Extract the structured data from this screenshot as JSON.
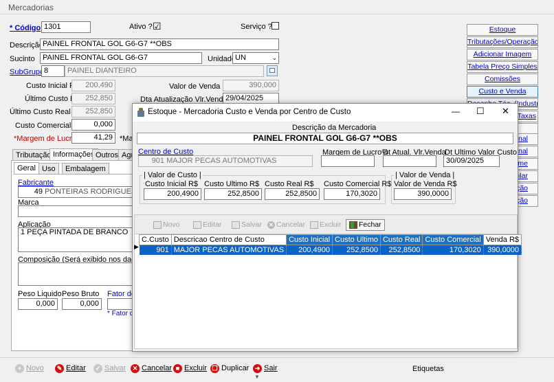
{
  "window_title": "Mercadorias",
  "form": {
    "codigo_label": "* Código",
    "codigo_value": "1301",
    "ativo_label": "Ativo ?",
    "ativo_checked": "☑",
    "servico_label": "Serviço ?",
    "descricao_label": "Descrição",
    "descricao_value": "PAINEL FRONTAL GOL G6-G7 **OBS",
    "sucinto_label": "Sucinto",
    "sucinto_value": "PAINEL FRONTAL GOL G6-G7",
    "unidade_label": "Unidade",
    "unidade_value": "UN",
    "subgrupo_label": "SubGrupo",
    "subgrupo_code": "8",
    "subgrupo_name": "PAINEL DIANTEIRO",
    "custo_inicial_label": "Custo Inicial R$",
    "custo_inicial_value": "200,490",
    "ultimo_custo_label": "Último Custo R$",
    "ultimo_custo_value": "252,850",
    "ultimo_custo_real_label": "Último Custo Real R$",
    "ultimo_custo_real_value": "252,850",
    "custo_comercial_label": "Custo Comercial R$",
    "custo_comercial_value": "0,000",
    "margem_label": "*Margem de Lucro%",
    "margem_value": "41,29",
    "margem_trunc": "*Ma",
    "valor_venda_label": "Valor de Venda R$",
    "valor_venda_value": "390,000",
    "dta_atualizacao_label": "Dta Atualização Vlr.Venda",
    "dta_atualizacao_value": "29/04/2025"
  },
  "tabs": [
    "Tributação",
    "Informações",
    "Outros",
    "Agr"
  ],
  "subtabs": [
    "Geral",
    "Uso",
    "Embalagem"
  ],
  "info": {
    "fabricante_label": "Fabricante",
    "fabricante_code": "49",
    "fabricante_name": "PONTEIRAS RODRIGUES",
    "marca_label": "Marca",
    "aplicacao_label": "Aplicação",
    "aplicacao_value": "1 PEÇA PINTADA DE BRANCO",
    "composicao_label": "Composição (Será exibido nos dados compl",
    "peso_liquido_label": "Peso Liquido",
    "peso_liquido_value": "0,000",
    "peso_bruto_label": "Peso Bruto",
    "peso_bruto_value": "0,000",
    "fator_label": "Fator de C",
    "fator_note": "* Fator de"
  },
  "right_buttons": [
    "Estoque",
    "Tributações/Operação",
    "Adicionar Imagem",
    "Tabela Preço Simples",
    "Comissões",
    "Custo e Venda",
    "Desenho Téc. (Industria)",
    "e Taxas",
    "ional",
    "ional",
    "lume",
    "milar",
    "ssição",
    "ição"
  ],
  "toolbar": {
    "novo": "Novo",
    "editar": "Editar",
    "salvar": "Salvar",
    "cancelar": "Cancelar",
    "excluir": "Excluir",
    "duplicar": "Duplicar",
    "sair": "Sair",
    "etiquetas": "Etiquetas"
  },
  "modal": {
    "title": "Estoque - Mercadoria Custo e Venda por Centro de Custo",
    "minimize": "—",
    "maximize": "☐",
    "close": "✕",
    "descricao_label": "Descrição da Mercadoria",
    "descricao_value": "PAINEL FRONTAL GOL G6-G7 **OBS",
    "centro_custo_label": "Centro de Custo",
    "centro_custo_code": "901",
    "centro_custo_name": "MAJOR PECAS AUTOMOTIVAS",
    "margem_label": "Margem de Lucro%",
    "dt_atual_label": "Dt Atual. Vlr.Venda",
    "dt_ultimo_label": "Dt Ultimo Valor Custo",
    "dt_ultimo_value": "30/09/2025",
    "valor_custo_group": "Valor de Custo",
    "custo_inicial_label": "Custo Inicial R$",
    "custo_inicial_value": "200,4900",
    "custo_ultimo_label": "Custo Ultimo R$",
    "custo_ultimo_value": "252,8500",
    "custo_real_label": "Custo Real R$",
    "custo_real_value": "252,8500",
    "custo_comercial_label": "Custo Comercial R$",
    "custo_comercial_value": "170,3020",
    "valor_venda_group": "Valor de Venda",
    "valor_venda_label": "Valor de Venda R$",
    "valor_venda_value": "390,0000",
    "buttons": {
      "novo": "Novo",
      "editar": "Editar",
      "salvar": "Salvar",
      "cancelar": "Cancelar",
      "excluir": "Excluir",
      "fechar": "Fechar"
    },
    "grid_headers": [
      "C.Custo",
      "Descricao Centro de Custo",
      "Custo Inicial",
      "Custo Ultimo",
      "Custo Real",
      "Custo Comercial",
      "Venda R$"
    ],
    "grid_rows": [
      [
        "901",
        "MAJOR PECAS AUTOMOTIVAS",
        "200,4900",
        "252,8500",
        "252,8500",
        "170,3020",
        "390,0000"
      ]
    ]
  }
}
